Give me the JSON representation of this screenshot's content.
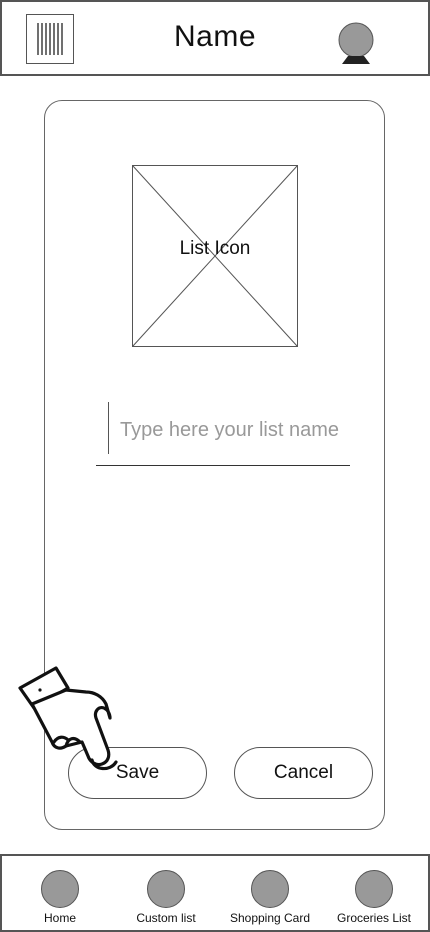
{
  "header": {
    "title": "Name",
    "menu_icon": "barcode-icon",
    "profile_icon": "user-avatar-icon"
  },
  "card": {
    "image_label": "List Icon",
    "image_icon": "image-placeholder-icon",
    "name_input": {
      "placeholder": "Type here your list name",
      "value": ""
    },
    "save_label": "Save",
    "cancel_label": "Cancel",
    "pointer_icon": "pointing-hand-icon"
  },
  "bottom_nav": {
    "items": [
      {
        "label": "Home",
        "icon": "circle-icon"
      },
      {
        "label": "Custom list",
        "icon": "circle-icon"
      },
      {
        "label": "Shopping Card",
        "icon": "circle-icon"
      },
      {
        "label": "Groceries List",
        "icon": "circle-icon"
      }
    ]
  },
  "colors": {
    "border": "#555555",
    "icon_fill": "#999999",
    "placeholder_text": "#999999"
  }
}
